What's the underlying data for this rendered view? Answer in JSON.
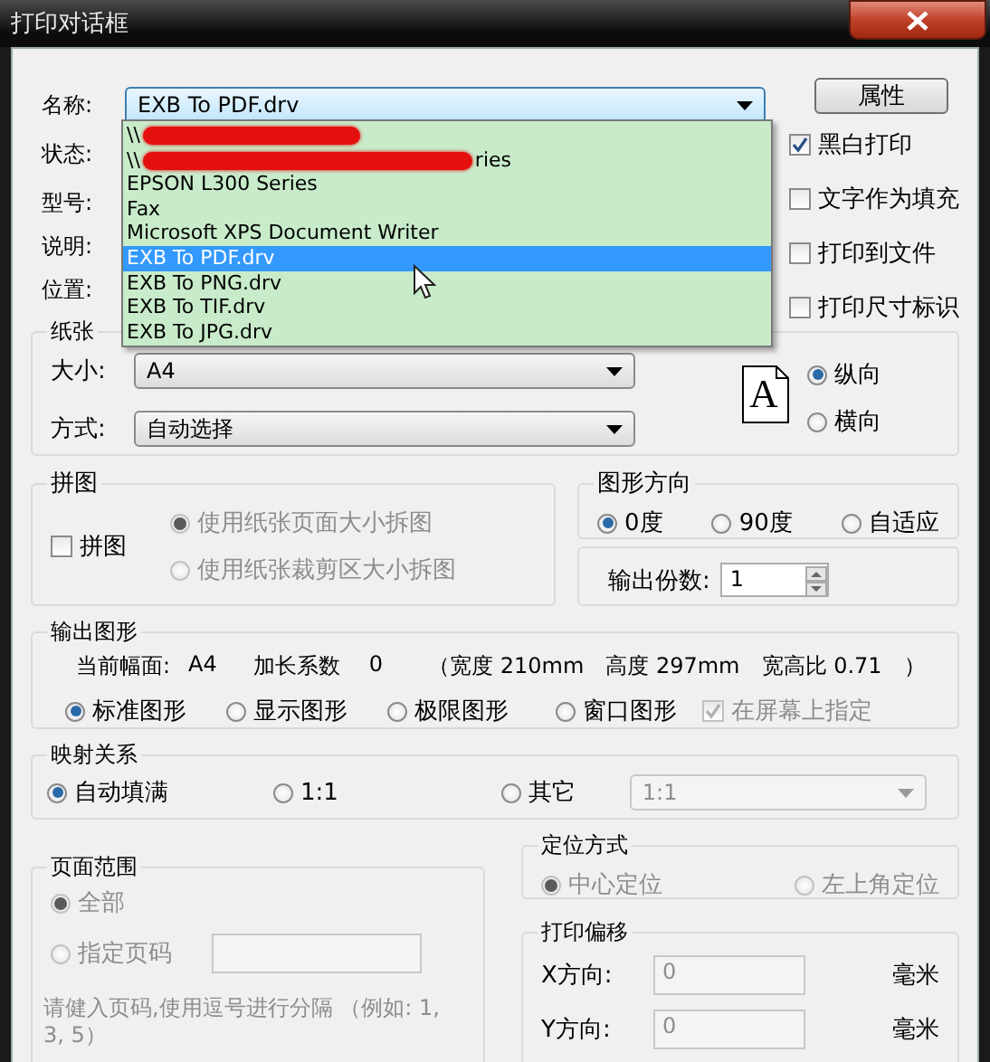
{
  "window": {
    "title": "打印对话框"
  },
  "printer": {
    "label": "名称:",
    "value": "EXB To PDF.drv",
    "properties_button": "属性"
  },
  "info_labels": [
    "状态:",
    "型号:",
    "说明:",
    "位置:"
  ],
  "options": [
    {
      "label": "黑白打印",
      "checked": true
    },
    {
      "label": "文字作为填充",
      "checked": false
    },
    {
      "label": "打印到文件",
      "checked": false
    },
    {
      "label": "打印尺寸标识",
      "checked": false
    }
  ],
  "dropdown": {
    "items": [
      {
        "kind": "redacted",
        "text": "\\\\",
        "selected": false
      },
      {
        "kind": "redacted",
        "text": "\\\\",
        "tail": "ries",
        "selected": false
      },
      {
        "kind": "plain",
        "text": "EPSON L300 Series",
        "selected": false
      },
      {
        "kind": "plain",
        "text": "Fax",
        "selected": false
      },
      {
        "kind": "plain",
        "text": "Microsoft XPS Document Writer",
        "selected": false
      },
      {
        "kind": "plain",
        "text": "EXB To PDF.drv",
        "selected": true
      },
      {
        "kind": "plain",
        "text": "EXB To PNG.drv",
        "selected": false
      },
      {
        "kind": "plain",
        "text": "EXB To TIF.drv",
        "selected": false
      },
      {
        "kind": "plain",
        "text": "EXB To JPG.drv",
        "selected": false
      }
    ]
  },
  "paper": {
    "title": "纸张",
    "size": {
      "label": "大小:",
      "value": "A4"
    },
    "mode": {
      "label": "方式:",
      "value": "自动选择"
    },
    "page_glyph": "A",
    "orientations": [
      {
        "label": "纵向",
        "selected": true
      },
      {
        "label": "横向",
        "selected": false
      }
    ]
  },
  "tiling": {
    "title": "拼图",
    "checkbox": {
      "label": "拼图",
      "checked": false
    },
    "options": [
      {
        "label": "使用纸张页面大小拆图",
        "selected": true,
        "disabled": true
      },
      {
        "label": "使用纸张裁剪区大小拆图",
        "selected": false,
        "disabled": true
      }
    ]
  },
  "rotation": {
    "title": "图形方向",
    "options": [
      {
        "label": "0度",
        "selected": true
      },
      {
        "label": "90度",
        "selected": false
      },
      {
        "label": "自适应",
        "selected": false
      }
    ]
  },
  "copies": {
    "label": "输出份数:",
    "value": "1"
  },
  "output": {
    "title": "输出图形",
    "info": [
      "当前幅面:",
      "A4",
      "加长系数",
      "0",
      "（宽度 210mm",
      "高度 297mm",
      "宽高比 0.71",
      "）"
    ],
    "options": [
      {
        "label": "标准图形",
        "selected": true
      },
      {
        "label": "显示图形",
        "selected": false
      },
      {
        "label": "极限图形",
        "selected": false
      },
      {
        "label": "窗口图形",
        "selected": false
      }
    ],
    "on_screen": {
      "label": "在屏幕上指定",
      "checked": true,
      "disabled": true
    }
  },
  "mapping": {
    "title": "映射关系",
    "options": [
      {
        "label": "自动填满",
        "selected": true
      },
      {
        "label": "1:1",
        "selected": false
      },
      {
        "label": "其它",
        "selected": false
      }
    ],
    "ratio": {
      "value": "1:1",
      "disabled": true
    }
  },
  "page_range": {
    "title": "页面范围",
    "options": [
      {
        "label": "全部",
        "selected": true,
        "disabled": true
      },
      {
        "label": "指定页码",
        "selected": false,
        "disabled": true
      }
    ],
    "hint": "请健入页码,使用逗号进行分隔 （例如: 1, 3, 5）"
  },
  "positioning": {
    "title": "定位方式",
    "options": [
      {
        "label": "中心定位",
        "selected": true,
        "disabled": true
      },
      {
        "label": "左上角定位",
        "selected": false,
        "disabled": true
      }
    ]
  },
  "offset": {
    "title": "打印偏移",
    "rows": [
      {
        "label": "X方向:",
        "value": "0",
        "unit": "毫米"
      },
      {
        "label": "Y方向:",
        "value": "0",
        "unit": "毫米"
      }
    ]
  }
}
